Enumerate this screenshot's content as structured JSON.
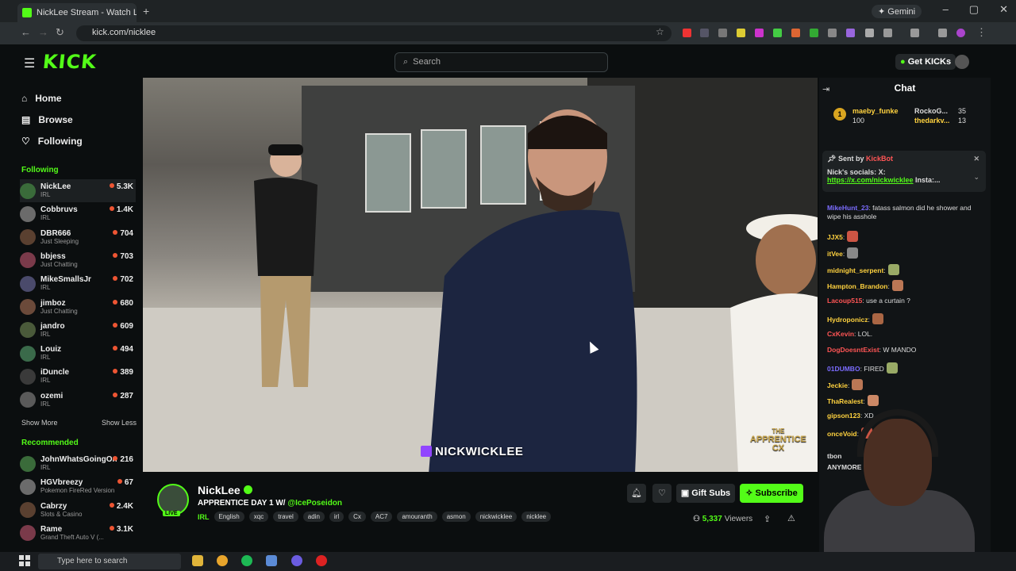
{
  "browser": {
    "tab_title": "NickLee Stream - Watch Li",
    "new_tab": "+",
    "gemini": "Gemini",
    "window_controls": [
      "–",
      "▢",
      "✕"
    ],
    "url": "kick.com/nicklee"
  },
  "header": {
    "logo": "KICK",
    "search_placeholder": "Search",
    "get_kicks": "Get KICKs"
  },
  "sidebar": {
    "nav": [
      {
        "label": "Home",
        "icon": "home-icon"
      },
      {
        "label": "Browse",
        "icon": "browse-icon"
      },
      {
        "label": "Following",
        "icon": "heart-icon"
      }
    ],
    "following_title": "Following",
    "following": [
      {
        "name": "NickLee",
        "category": "IRL",
        "viewers": "5.3K"
      },
      {
        "name": "Cobbruvs",
        "category": "IRL",
        "viewers": "1.4K"
      },
      {
        "name": "DBR666",
        "category": "Just Sleeping",
        "viewers": "704"
      },
      {
        "name": "bbjess",
        "category": "Just Chatting",
        "viewers": "703"
      },
      {
        "name": "MikeSmallsJr",
        "category": "IRL",
        "viewers": "702"
      },
      {
        "name": "jimboz",
        "category": "Just Chatting",
        "viewers": "680"
      },
      {
        "name": "jandro",
        "category": "IRL",
        "viewers": "609"
      },
      {
        "name": "Louiz",
        "category": "IRL",
        "viewers": "494"
      },
      {
        "name": "iDuncle",
        "category": "IRL",
        "viewers": "389"
      },
      {
        "name": "ozemi",
        "category": "IRL",
        "viewers": "287"
      }
    ],
    "show_more": "Show More",
    "show_less": "Show Less",
    "recommended_title": "Recommended",
    "recommended": [
      {
        "name": "JohnWhatsGoingOn",
        "category": "IRL",
        "viewers": "216"
      },
      {
        "name": "HGVbreezy",
        "category": "Pokemon FireRed Version",
        "viewers": "67"
      },
      {
        "name": "Cabrzy",
        "category": "Slots & Casino",
        "viewers": "2.4K"
      },
      {
        "name": "Rame",
        "category": "Grand Theft Auto V (...",
        "viewers": "3.1K"
      }
    ]
  },
  "video": {
    "watermark": "NICKWICKLEE",
    "overlay_logo_line1": "THE",
    "overlay_logo_line2": "APPRENTICE",
    "overlay_logo_line3": "CX"
  },
  "stream_info": {
    "live": "LIVE",
    "streamer": "NickLee",
    "title_prefix": "APPRENTICE DAY 1 W/ ",
    "title_mention": "@IcePoseidon",
    "category": "IRL",
    "tags": [
      "English",
      "xqc",
      "travel",
      "adin",
      "irl",
      "Cx",
      "AC7",
      "amouranth",
      "asmon",
      "nickwicklee",
      "nicklee"
    ],
    "gift_subs": "Gift Subs",
    "subscribe": "Subscribe",
    "viewer_count": "5,337",
    "viewers_label": "Viewers"
  },
  "chat": {
    "title": "Chat",
    "top_gifters": [
      {
        "rank": "1",
        "name": "maeby_funke",
        "amount": "100"
      },
      {
        "name": "RockoG...",
        "amount": "35"
      },
      {
        "name": "thedarkv...",
        "amount": "13"
      }
    ],
    "pinned": {
      "sent_by": "Sent by",
      "sender": "KickBot",
      "line1": "Nick's socials: X:",
      "link": "https://x.com/nickwicklee",
      "line2_suffix": " Insta:..."
    },
    "messages": [
      {
        "user": "MikeHunt_23",
        "text": ": fatass salmon did he shower and wipe his asshole",
        "color": "#7b6cff"
      },
      {
        "user": "wipe",
        "text": "",
        "color": "#ddd"
      },
      {
        "user": "JJX5",
        "text": ":",
        "color": "#ffd23f"
      },
      {
        "user": "itVee",
        "text": ":",
        "color": "#ffd23f"
      },
      {
        "user": "midnight_serpent",
        "text": ":",
        "color": "#ffd23f"
      },
      {
        "user": "Hampton_Brandon",
        "text": ":",
        "color": "#ffd23f"
      },
      {
        "user": "Lacoup515",
        "text": ": use a curtain ?",
        "color": "#ff5555"
      },
      {
        "user": "Hydroponicz",
        "text": ":",
        "color": "#ffd23f"
      },
      {
        "user": "CxKevin",
        "text": ": LOL.",
        "color": "#ff5555"
      },
      {
        "user": "DogDoesntExist",
        "text": ": W MANDO",
        "color": "#ff5555"
      },
      {
        "user": "01DUMBO",
        "text": ": FIRED",
        "color": "#7b6cff"
      },
      {
        "user": "Jeckie",
        "text": ":",
        "color": "#ffd23f"
      },
      {
        "user": "ThaRealest",
        "text": ":",
        "color": "#ffd23f"
      },
      {
        "user": "gipson123",
        "text": ": XD",
        "color": "#ffd23f"
      },
      {
        "user": "onceVoid",
        "text": ":",
        "color": "#ffd23f"
      },
      {
        "user": "tbon",
        "text": "",
        "color": "#ddd"
      },
      {
        "user": "ANYMORE",
        "text": "",
        "color": "#ddd"
      }
    ]
  },
  "taskbar": {
    "search_placeholder": "Type here to search"
  },
  "colors": {
    "accent": "#53fc18",
    "background": "#0b0e0f",
    "chat_bg": "#111416"
  }
}
